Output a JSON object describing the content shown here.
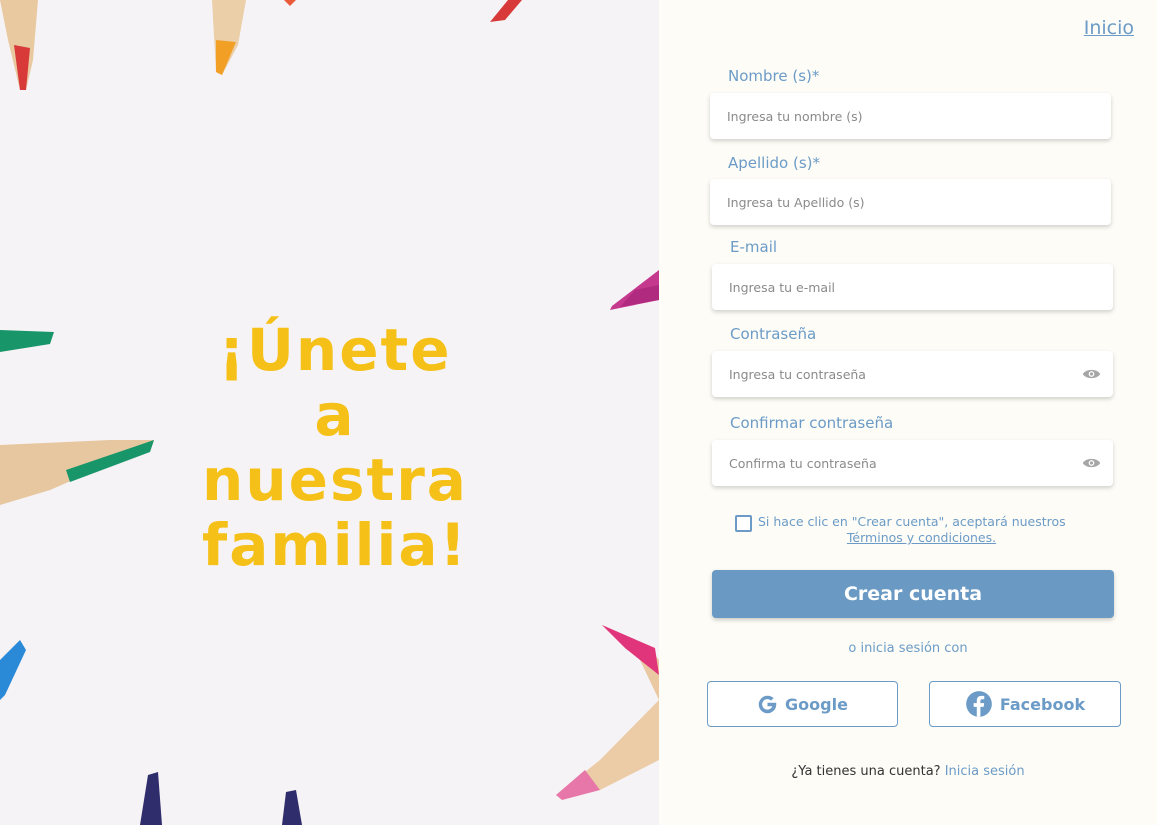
{
  "hero": {
    "headline_line1": "¡Únete a",
    "headline_line2": "nuestra",
    "headline_line3": "familia!"
  },
  "nav": {
    "home_link": "Inicio"
  },
  "form": {
    "first_name": {
      "label": "Nombre (s)*",
      "placeholder": "Ingresa tu nombre (s)",
      "value": ""
    },
    "last_name": {
      "label": "Apellido (s)*",
      "placeholder": "Ingresa tu Apellido (s)",
      "value": ""
    },
    "email": {
      "label": "E-mail",
      "placeholder": "Ingresa tu e-mail",
      "value": ""
    },
    "password": {
      "label": "Contraseña",
      "placeholder": "Ingresa tu contraseña",
      "value": ""
    },
    "confirm_password": {
      "label": "Confirmar contraseña",
      "placeholder": "Confirma tu contraseña",
      "value": ""
    },
    "terms_text": "Si hace clic en \"Crear cuenta\", aceptará nuestros",
    "terms_link": "Términos y condiciones.",
    "terms_checked": false,
    "submit_label": "Crear cuenta"
  },
  "social": {
    "divider_text": "o inicia sesión con",
    "google_label": "Google",
    "facebook_label": "Facebook"
  },
  "footer": {
    "question": "¿Ya tienes una cuenta?",
    "login_link": "Inicia sesión"
  },
  "colors": {
    "accent": "#6a9ac4",
    "headline": "#f5c018",
    "panel_bg": "#fdfcf7"
  },
  "icons": [
    "google-icon",
    "facebook-icon",
    "eye-icon"
  ]
}
